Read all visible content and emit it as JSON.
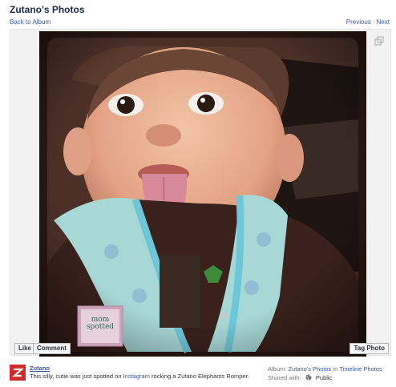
{
  "header": {
    "title": "Zutano's Photos",
    "back_label": "Back to Album",
    "previous_label": "Previous",
    "separator": "·",
    "next_label": "Next"
  },
  "photo": {
    "watermark_text": "mom spotted",
    "expand_icon": "expand-icon"
  },
  "actions": {
    "like_label": "Like",
    "comment_label": "Comment",
    "tag_label": "Tag Photo"
  },
  "post": {
    "poster_name": "Zutano",
    "caption_before": "This silly, cutie was just spotted on ",
    "caption_link": "Instagram",
    "caption_after": " rocking a Zutano Elephants Romper.",
    "album_label": "Album:",
    "album_link": "Zutano's Photos",
    "album_in": " in ",
    "album_timeline": "Timeline Photos",
    "shared_label": "Shared with:",
    "privacy_icon": "globe-icon",
    "privacy_value": "Public"
  },
  "colors": {
    "link": "#3b5998",
    "title": "#1c2a47",
    "brand_red": "#d22a2a",
    "photo_frame": "#2a1712"
  }
}
